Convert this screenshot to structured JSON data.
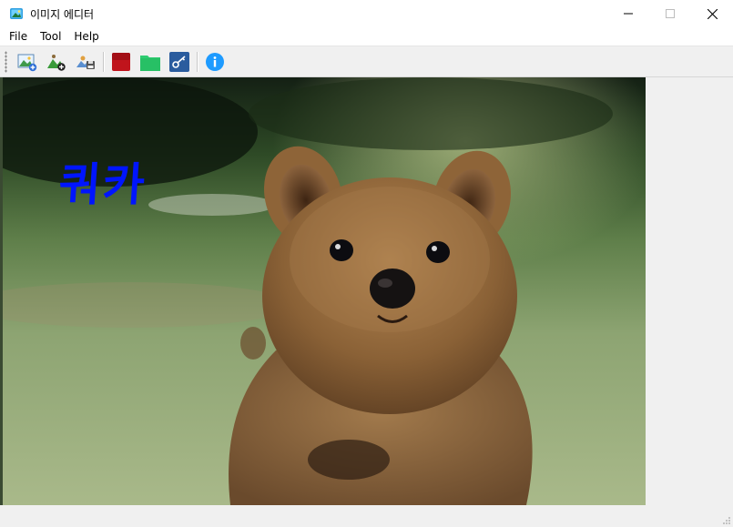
{
  "window": {
    "title": "이미지 에디터",
    "icon": "app-icon"
  },
  "menu": {
    "file": "File",
    "tool": "Tool",
    "help": "Help"
  },
  "toolbar": {
    "buttons": [
      {
        "name": "open-image-icon"
      },
      {
        "name": "add-image-icon"
      },
      {
        "name": "save-image-icon"
      },
      {
        "name": "red-color-icon",
        "color": "#c0141c"
      },
      {
        "name": "green-color-icon",
        "color": "#2ecc71"
      },
      {
        "name": "key-icon"
      },
      {
        "name": "info-icon"
      }
    ]
  },
  "canvas": {
    "drawn_text": "쿼카",
    "drawn_text_color": "#0015ff",
    "subject": "quokka photo"
  }
}
